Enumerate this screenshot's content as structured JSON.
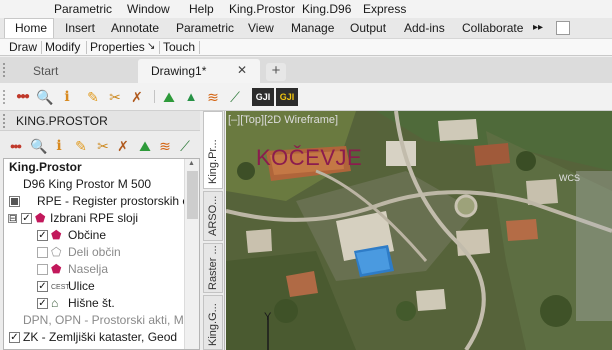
{
  "menu": [
    "Parametric",
    "Window",
    "Help",
    "King.Prostor",
    "King.D96",
    "Express"
  ],
  "ribbon_tabs": [
    "Home",
    "Insert",
    "Annotate",
    "Parametric",
    "View",
    "Manage",
    "Output",
    "Add-ins",
    "Collaborate"
  ],
  "ribbon_overflow": "▸▸",
  "panels": [
    "Draw",
    "Modify",
    "Properties",
    "Touch"
  ],
  "properties_arrow": "↘",
  "file_tabs": {
    "start": "Start",
    "drawing": "Drawing1*",
    "close": "✕",
    "add": "+"
  },
  "palette": {
    "title": "KING.PROSTOR",
    "tree": {
      "root": "King.Prostor",
      "items": [
        {
          "label": "D96 King Prostor M 500",
          "indent": 1
        },
        {
          "label": "RPE - Register prostorskih en",
          "indent": 1,
          "checkbox": "partial"
        },
        {
          "label": "Izbrani RPE sloji",
          "indent": 1,
          "checkbox": "checked",
          "expander": "⊟"
        },
        {
          "label": "Občine",
          "indent": 2,
          "checkbox": "checked"
        },
        {
          "label": "Deli občin",
          "indent": 2,
          "checkbox": "unchecked",
          "dim": true
        },
        {
          "label": "Naselja",
          "indent": 2,
          "checkbox": "unchecked",
          "dim": true
        },
        {
          "label": "Ulice",
          "indent": 2,
          "checkbox": "checked"
        },
        {
          "label": "Hišne št.",
          "indent": 2,
          "checkbox": "checked"
        },
        {
          "label": "DPN, OPN - Prostorski akti, Min",
          "indent": 1,
          "dim": true
        },
        {
          "label": "ZK - Zemljiški kataster, Geod",
          "indent": 1,
          "checkbox": "checked"
        }
      ]
    },
    "side_tabs": [
      "King.Pr...",
      "ARSO...",
      "Raster ...",
      "King.G..."
    ]
  },
  "map": {
    "viewport_label": "[–][Top][2D Wireframe]",
    "overlay_text": "KOČEVJE",
    "overlay_color": "#8b1c4e",
    "ucs_label": "Y",
    "viewcube_label": "WCS"
  },
  "colors": {
    "accent": "#2a62b5",
    "tab_active": "#ffffff",
    "map_text": "#8b1c4e"
  }
}
